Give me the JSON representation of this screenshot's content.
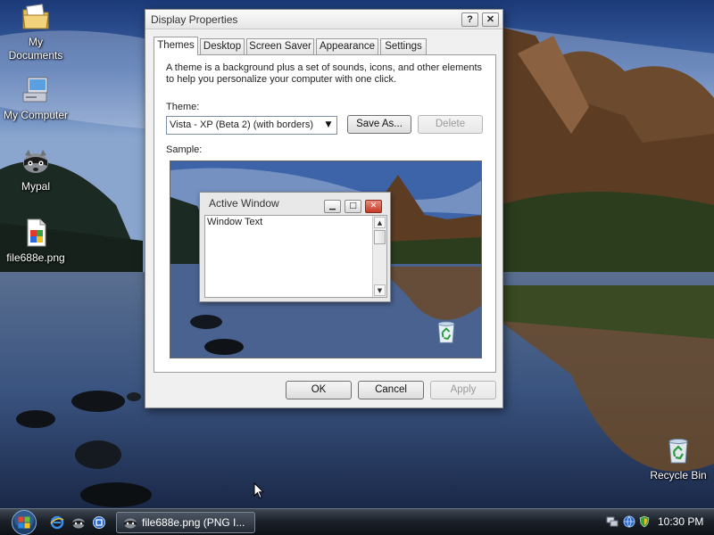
{
  "desktop": {
    "icons": [
      {
        "label_line1": "My",
        "label_line2": "Documents",
        "icon": "folder-documents-icon"
      },
      {
        "label": "My Computer",
        "icon": "computer-icon"
      },
      {
        "label": "Mypal",
        "icon": "raccoon-browser-icon"
      },
      {
        "label": "file688e.png",
        "icon": "png-file-icon"
      },
      {
        "label": "Recycle Bin",
        "icon": "recycle-bin-icon"
      }
    ]
  },
  "dialog": {
    "title": "Display Properties",
    "help_label": "?",
    "close_label": "✕",
    "tabs": [
      {
        "label": "Themes",
        "active": true
      },
      {
        "label": "Desktop"
      },
      {
        "label": "Screen Saver"
      },
      {
        "label": "Appearance"
      },
      {
        "label": "Settings"
      }
    ],
    "description": "A theme is a background plus a set of sounds, icons, and other elements to help you personalize your computer with one click.",
    "theme_label": "Theme:",
    "theme_value": "Vista - XP (Beta 2) (with borders)",
    "save_as_label": "Save As...",
    "delete_label": "Delete",
    "sample_label": "Sample:",
    "preview": {
      "window_title": "Active Window",
      "window_text": "Window Text"
    },
    "ok_label": "OK",
    "cancel_label": "Cancel",
    "apply_label": "Apply"
  },
  "taskbar": {
    "task_label": "file688e.png (PNG I...",
    "clock": "10:30 PM"
  },
  "colors": {
    "taskbar": "#1c222a",
    "dialog_bg": "#f0f0f0",
    "close_red": "#c43b26"
  }
}
